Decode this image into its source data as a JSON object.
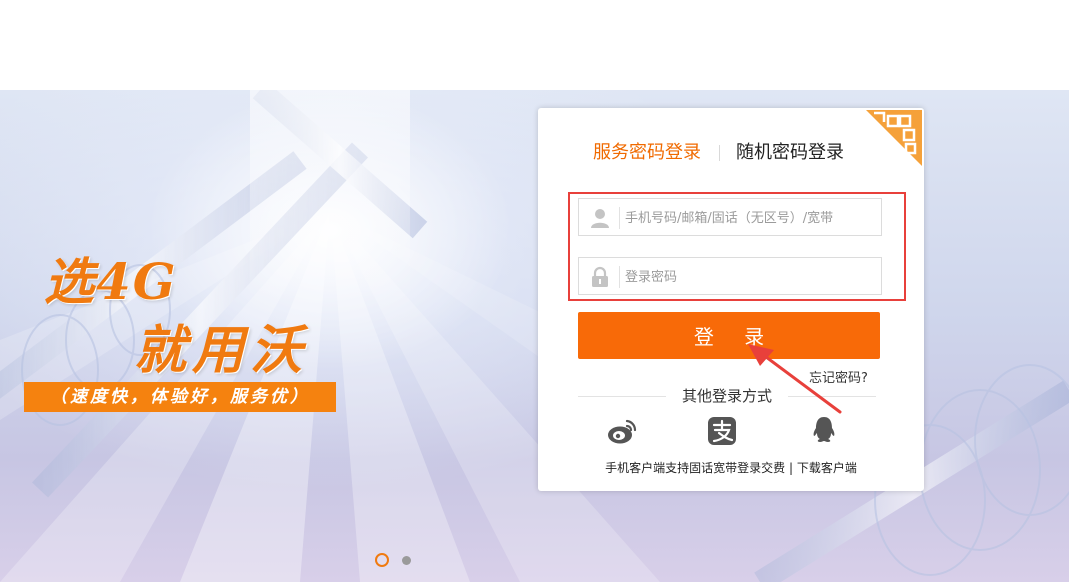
{
  "banner": {
    "slogan_line1": "选4G",
    "slogan_line2": "就用沃",
    "tagline": "（速度快，体验好，服务优）",
    "carousel": {
      "total": 2,
      "active": 1
    }
  },
  "login": {
    "tabs": [
      {
        "label": "服务密码登录",
        "active": true
      },
      {
        "label": "随机密码登录",
        "active": false
      }
    ],
    "username_placeholder": "手机号码/邮箱/固话（无区号）/宽带",
    "password_placeholder": "登录密码",
    "submit_label": "登 录",
    "forgot_label": "忘记密码?",
    "other_methods_label": "其他登录方式",
    "social": [
      {
        "name": "weibo-icon"
      },
      {
        "name": "alipay-icon"
      },
      {
        "name": "qq-icon"
      }
    ],
    "footer": {
      "text": "手机客户端支持固话宽带登录交费",
      "separator": " | ",
      "download_link": "下载客户端"
    }
  },
  "colors": {
    "accent": "#f86a08",
    "tab_active": "#f06a00",
    "highlight_box": "#e8403b"
  }
}
